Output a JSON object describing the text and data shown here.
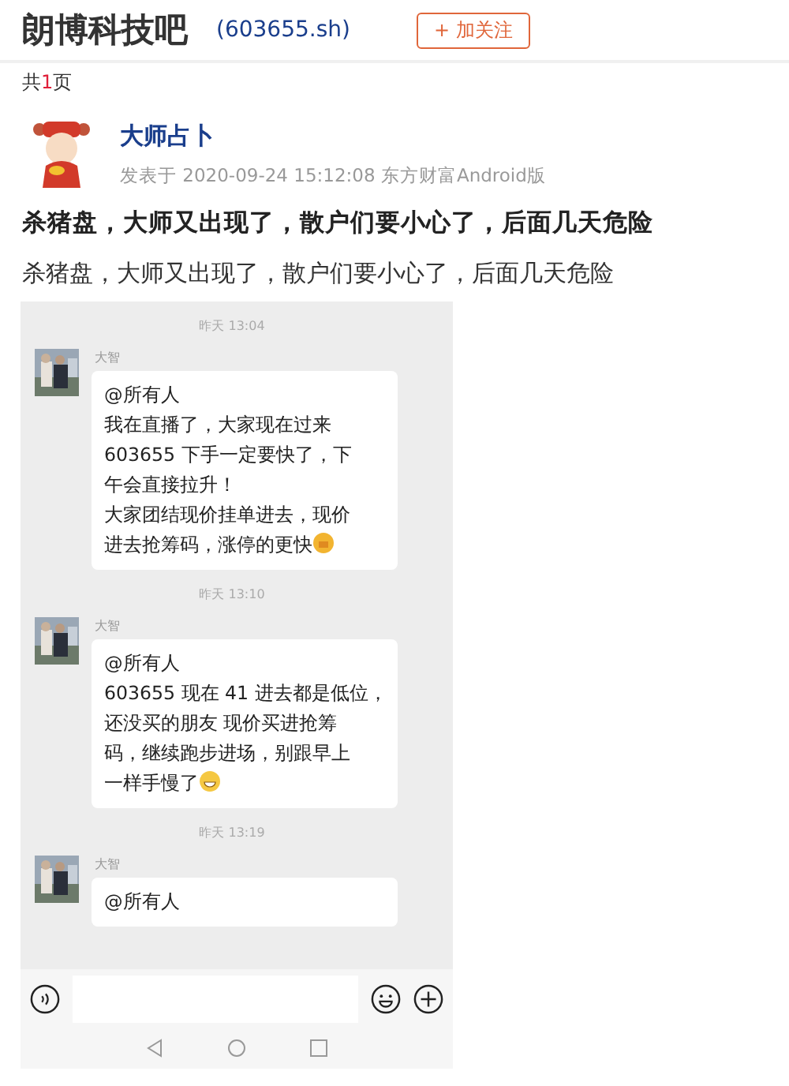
{
  "header": {
    "title": "朗博科技吧",
    "code": "(603655.sh)",
    "follow_button": "+ 加关注"
  },
  "pager": {
    "prefix": "共",
    "count": "1",
    "suffix": "页"
  },
  "post": {
    "author": "大师占卜",
    "meta": "发表于 2020-09-24 15:12:08 东方财富Android版",
    "title": "杀猪盘，大师又出现了，散户们要小心了，后面几天危险",
    "body": "杀猪盘，大师又出现了，散户们要小心了，后面几天危险"
  },
  "chat": {
    "items": [
      {
        "kind": "time",
        "text": "昨天 13:04"
      },
      {
        "kind": "message",
        "sender": "大智",
        "lines": [
          "@所有人",
          "我在直播了，大家现在过来",
          "603655 下手一定要快了，下",
          "午会直接拉升！",
          "大家团结现价挂单进去，现价",
          "进去抢筹码，涨停的更快"
        ],
        "emoji": {
          "kind": "fist"
        }
      },
      {
        "kind": "time",
        "text": "昨天 13:10"
      },
      {
        "kind": "message",
        "sender": "大智",
        "lines": [
          "@所有人",
          "603655 现在 41 进去都是低位，",
          "还没买的朋友 现价买进抢筹",
          "码，继续跑步进场，别跟早上",
          "一样手慢了"
        ],
        "emoji": {
          "kind": "grin"
        }
      },
      {
        "kind": "time",
        "text": "昨天 13:19"
      },
      {
        "kind": "message",
        "sender": "大智",
        "lines": [
          "@所有人"
        ]
      }
    ]
  }
}
